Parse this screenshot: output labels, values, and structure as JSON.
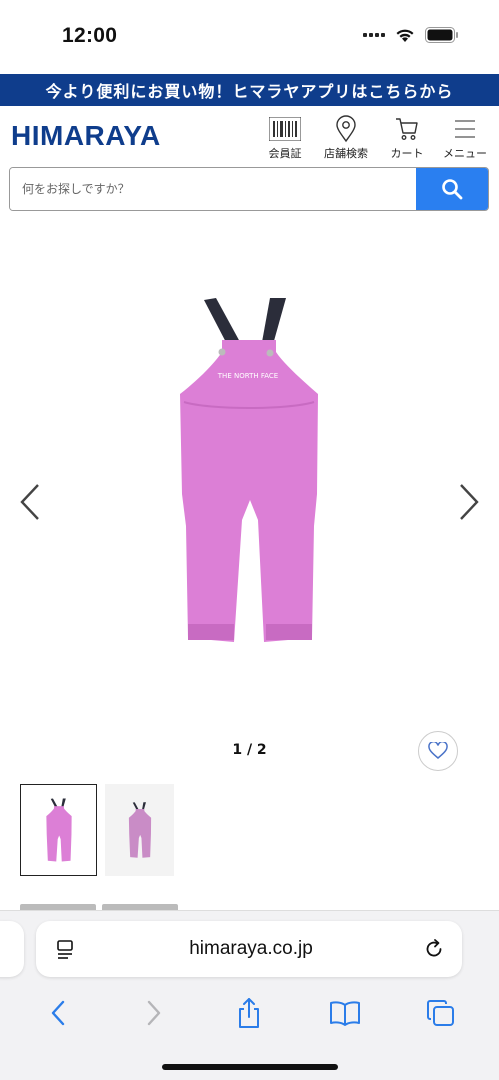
{
  "status_bar": {
    "time": "12:00"
  },
  "banner": {
    "text": "今より便利にお買い物！ヒマラヤアプリはこちらから"
  },
  "header": {
    "logo": "HIMARAYA",
    "nav": [
      {
        "label": "会員証",
        "icon": "barcode-icon"
      },
      {
        "label": "店舗検索",
        "icon": "location-pin-icon"
      },
      {
        "label": "カート",
        "icon": "cart-icon"
      },
      {
        "label": "メニュー",
        "icon": "hamburger-menu-icon"
      }
    ]
  },
  "search": {
    "placeholder": "何をお探しですか？",
    "value": ""
  },
  "product": {
    "pager": "1 / 2",
    "image_color": "#dc7fd6",
    "strap_color": "#2b2d3a",
    "thumbnails": 2
  },
  "browser": {
    "url": "himaraya.co.jp"
  },
  "colors": {
    "brand": "#0f3d8c",
    "search_button": "#2a7ff0",
    "safari_blue": "#2b7de9"
  }
}
